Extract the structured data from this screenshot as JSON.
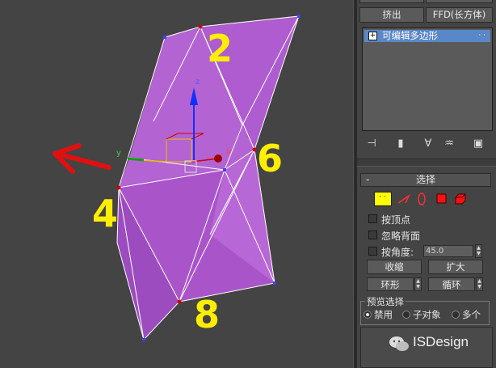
{
  "viewport": {
    "vertex_labels": [
      "2",
      "6",
      "4",
      "8"
    ],
    "gizmo_axes": {
      "x": "x",
      "y": "y",
      "z": "z"
    },
    "colors": {
      "mesh": "#b25fd0",
      "mesh_dark": "#9a49bb",
      "label": "#ffee00",
      "arrow": "#e01010",
      "vertex": "#cc0000",
      "corner_vertex": "#4040ff"
    }
  },
  "panel": {
    "top_buttons": {
      "extrude": "挤出",
      "ffd": "FFD(长方体)"
    },
    "modifier_stack": {
      "items": [
        "可编辑多边形"
      ]
    },
    "selection_rollout": {
      "collapse": "-",
      "title": "选择",
      "checkboxes": {
        "by_vertex": "按顶点",
        "ignore_backfacing": "忽略背面",
        "by_angle": "按角度:"
      },
      "angle_value": "45.0",
      "buttons": {
        "shrink": "收缩",
        "grow": "扩大",
        "ring": "环形",
        "loop": "循环"
      },
      "preview": {
        "label": "预览选择",
        "options": [
          "禁用",
          "子对象",
          "多个"
        ],
        "selected": "禁用"
      },
      "watermark": "ISDesign"
    }
  }
}
